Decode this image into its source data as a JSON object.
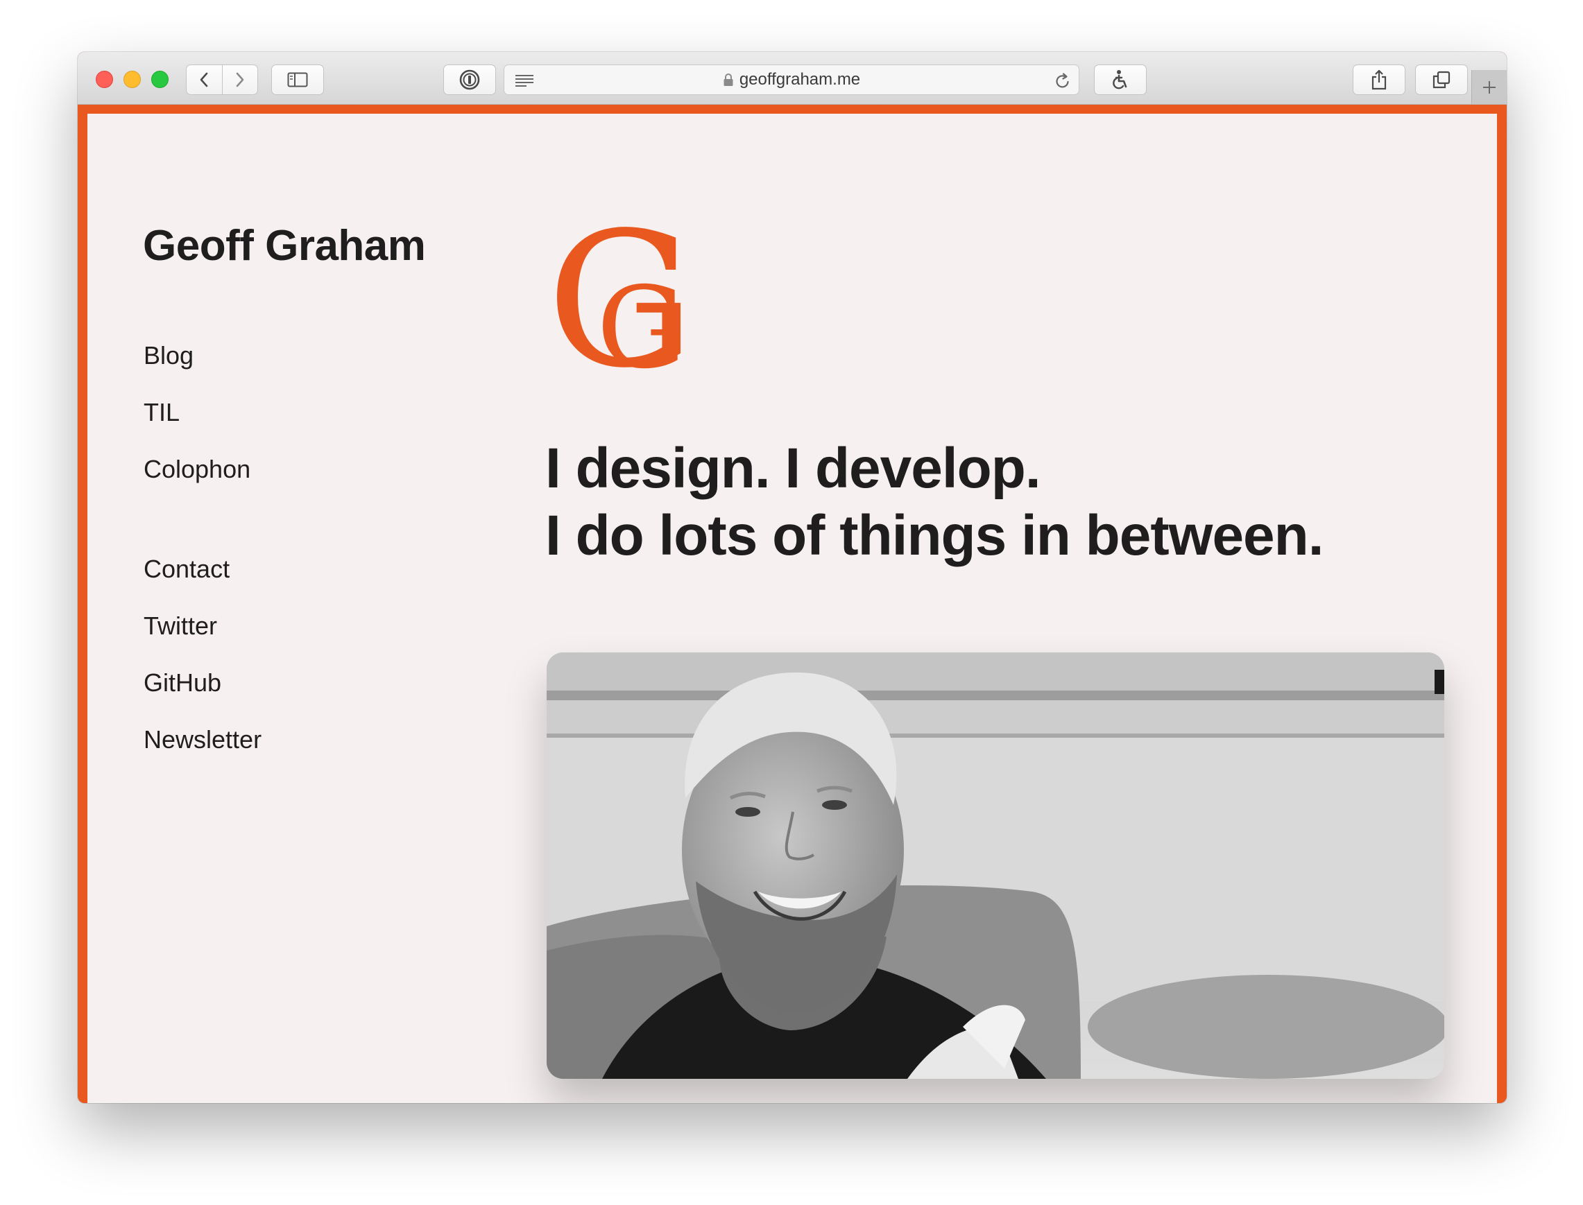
{
  "browser": {
    "url": "geoffgraham.me",
    "icons": {
      "close": "close-dot",
      "minimize": "minimize-dot",
      "maximize": "maximize-dot",
      "back": "chevron-left-icon",
      "forward": "chevron-right-icon",
      "sidebar": "sidebar-icon",
      "password": "password-manager-icon",
      "reader": "reader-icon",
      "lock": "lock-icon",
      "reload": "reload-icon",
      "accessibility": "accessibility-icon",
      "share": "share-icon",
      "tabs": "tabs-icon",
      "new_tab": "plus-icon"
    }
  },
  "site": {
    "title": "Geoff Graham",
    "logo_letters": "GG",
    "nav_primary": [
      "Blog",
      "TIL",
      "Colophon"
    ],
    "nav_secondary": [
      "Contact",
      "Twitter",
      "GitHub",
      "Newsletter"
    ],
    "tagline": [
      "I design. I develop.",
      "I do lots of things in between."
    ],
    "photo_icon": "portrait-photo"
  },
  "colors": {
    "accent": "#e9591f",
    "page_background": "#f6f0f0",
    "text": "#1f1d1d"
  }
}
